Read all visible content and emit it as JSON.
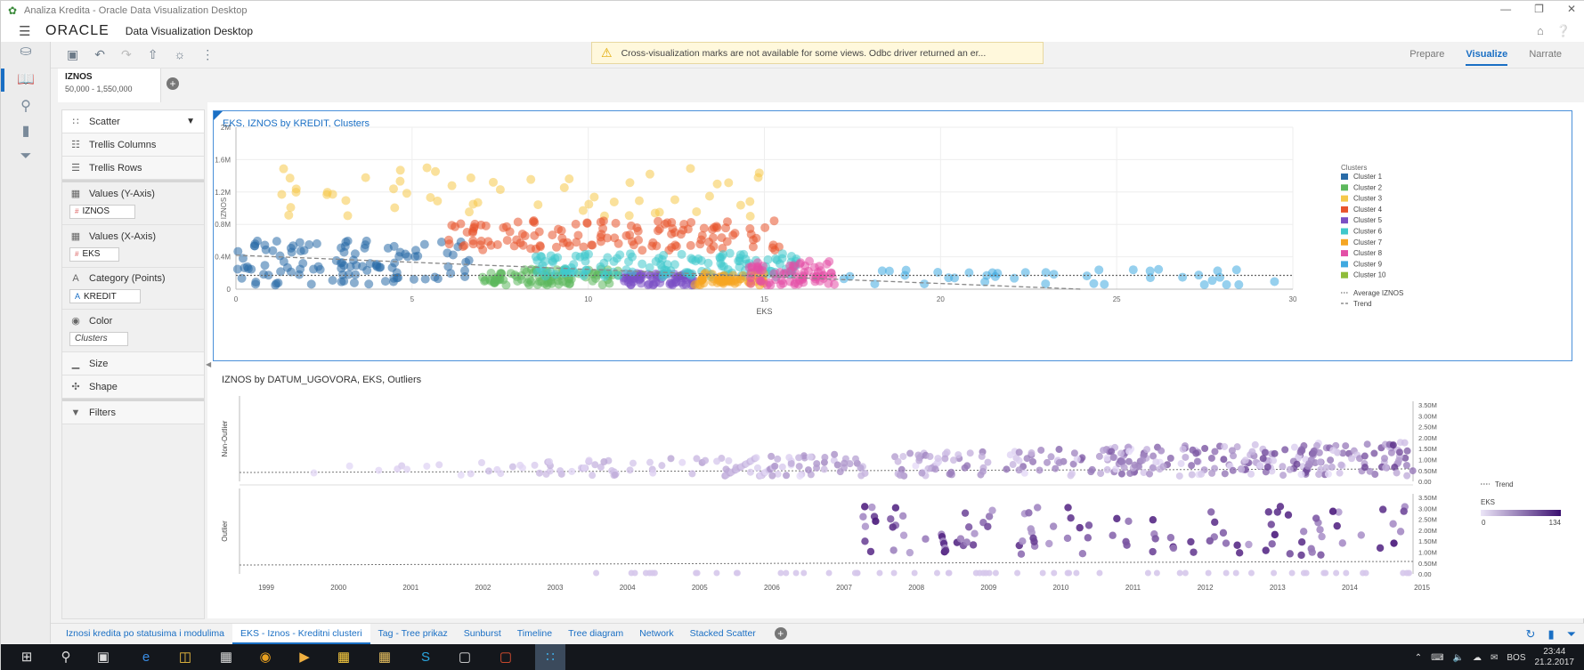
{
  "window": {
    "title": "Analiza Kredita - Oracle Data Visualization Desktop"
  },
  "header": {
    "logo": "ORACLE",
    "app_title": "Data Visualization Desktop"
  },
  "warning": {
    "text": "Cross-visualization marks are not available for some views. Odbc driver returned an er..."
  },
  "modes": {
    "prepare": "Prepare",
    "visualize": "Visualize",
    "narrate": "Narrate"
  },
  "filter": {
    "name": "IZNOS",
    "range": "50,000 - 1,550,000"
  },
  "panel": {
    "viz_type": "Scatter",
    "trellis_columns": "Trellis Columns",
    "trellis_rows": "Trellis Rows",
    "values_y": "Values (Y-Axis)",
    "values_y_pill": "IZNOS",
    "values_x": "Values (X-Axis)",
    "values_x_pill": "EKS",
    "category": "Category (Points)",
    "category_pill": "KREDIT",
    "color": "Color",
    "color_pill": "Clusters",
    "size": "Size",
    "shape": "Shape",
    "filters": "Filters"
  },
  "tabs": [
    "Iznosi kredita po statusima i modulima",
    "EKS - Iznos - Kreditni clusteri",
    "Tag - Tree prikaz",
    "Sunburst",
    "Timeline",
    "Tree diagram",
    "Network",
    "Stacked Scatter"
  ],
  "taskbar": {
    "lang": "BOS",
    "time": "23:44",
    "date": "21.2.2017"
  },
  "chart_data": [
    {
      "type": "scatter",
      "title": "EKS, IZNOS by KREDIT, Clusters",
      "xlabel": "EKS",
      "ylabel": "IZNOS",
      "xlim": [
        0,
        30
      ],
      "ylim": [
        0,
        2000000
      ],
      "x_ticks": [
        "0",
        "5",
        "10",
        "15",
        "20",
        "25",
        "30"
      ],
      "y_ticks": [
        "0",
        "0.4M",
        "0.8M",
        "1.2M",
        "1.6M",
        "2M"
      ],
      "grid": true,
      "legend_title": "Clusters",
      "legend_position": "right",
      "reference_lines": [
        "Average IZNOS",
        "Trend"
      ],
      "average_iznos": 170000,
      "trend": [
        [
          0,
          420000
        ],
        [
          24,
          0
        ]
      ],
      "series": [
        {
          "name": "Cluster 1",
          "color": "#2a6ca8",
          "x_range": [
            0,
            6.8
          ],
          "y_range": [
            50000,
            600000
          ],
          "n": 110
        },
        {
          "name": "Cluster 2",
          "color": "#5cb85c",
          "x_range": [
            7,
            11
          ],
          "y_range": [
            50000,
            250000
          ],
          "n": 90
        },
        {
          "name": "Cluster 3",
          "color": "#f5c84a",
          "x_range": [
            1.3,
            15.3
          ],
          "y_range": [
            900000,
            1500000
          ],
          "n": 55
        },
        {
          "name": "Cluster 4",
          "color": "#e8532b",
          "x_range": [
            5.8,
            15.5
          ],
          "y_range": [
            480000,
            850000
          ],
          "n": 130
        },
        {
          "name": "Cluster 5",
          "color": "#7a4fc4",
          "x_range": [
            11,
            13
          ],
          "y_range": [
            50000,
            200000
          ],
          "n": 70
        },
        {
          "name": "Cluster 6",
          "color": "#3fc8cc",
          "x_range": [
            8.5,
            16
          ],
          "y_range": [
            150000,
            450000
          ],
          "n": 140
        },
        {
          "name": "Cluster 7",
          "color": "#f5a623",
          "x_range": [
            13,
            15
          ],
          "y_range": [
            50000,
            200000
          ],
          "n": 60
        },
        {
          "name": "Cluster 8",
          "color": "#e34fa6",
          "x_range": [
            14.5,
            17
          ],
          "y_range": [
            50000,
            350000
          ],
          "n": 70
        },
        {
          "name": "Cluster 9",
          "color": "#3fa9e0",
          "x_range": [
            17,
            29.5
          ],
          "y_range": [
            50000,
            250000
          ],
          "n": 40
        },
        {
          "name": "Cluster 10",
          "color": "#8fbc3a",
          "x_range": [
            7,
            9
          ],
          "y_range": [
            100000,
            250000
          ],
          "n": 0
        }
      ]
    },
    {
      "type": "scatter",
      "title": "IZNOS by DATUM_UGOVORA, EKS, Outliers",
      "x_ticks": [
        "1999",
        "2000",
        "2001",
        "2002",
        "2003",
        "2004",
        "2005",
        "2006",
        "2007",
        "2008",
        "2009",
        "2010",
        "2011",
        "2012",
        "2013",
        "2014",
        "2015"
      ],
      "row_labels": [
        "Non-Outlier",
        "Outlier"
      ],
      "y_ticks": [
        "3.50M",
        "3.00M",
        "2.50M",
        "2.00M",
        "1.50M",
        "1.00M",
        "0.50M",
        "0.00"
      ],
      "legend": {
        "trend": "Trend",
        "color_title": "EKS",
        "color_min": "0",
        "color_max": "134"
      }
    }
  ]
}
